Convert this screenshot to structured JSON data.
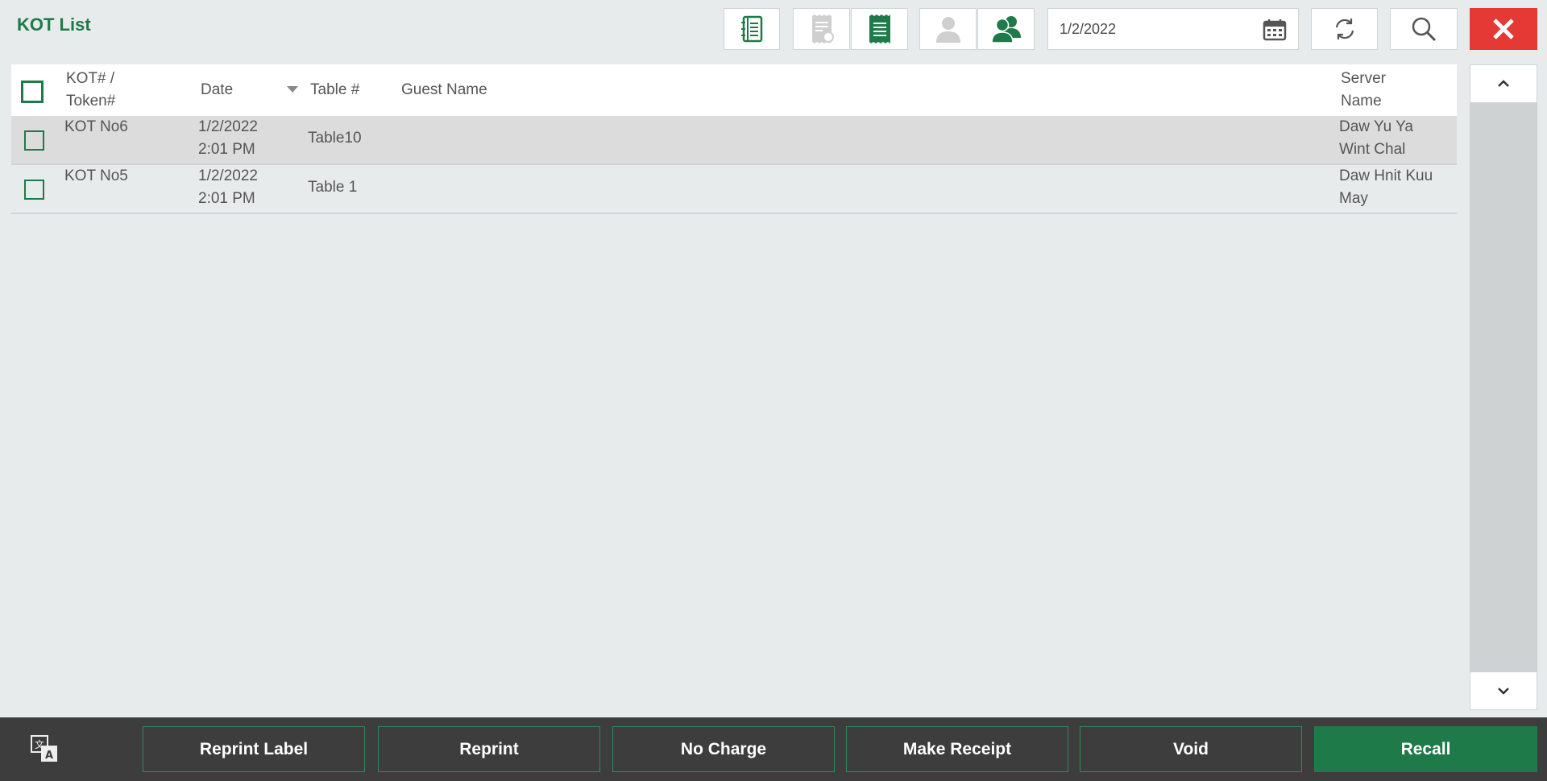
{
  "header": {
    "title": "KOT List",
    "date_value": "1/2/2022"
  },
  "toolbar": {
    "icons": [
      "kot-book-icon",
      "receipt-disabled-icon",
      "receipt-icon",
      "single-user-icon",
      "group-users-icon",
      "calendar-icon",
      "refresh-icon",
      "search-icon",
      "close-icon"
    ]
  },
  "table": {
    "headers": {
      "kot_line1": "KOT# /",
      "kot_line2": "Token#",
      "date": "Date",
      "table": "Table #",
      "guest": "Guest Name",
      "server_line1": "Server",
      "server_line2": "Name"
    },
    "rows": [
      {
        "kot": "KOT No6",
        "date_line1": "1/2/2022",
        "date_line2": "2:01 PM",
        "table": "Table10",
        "guest": "",
        "server_line1": "Daw Yu Ya",
        "server_line2": "Wint Chal",
        "highlighted": true
      },
      {
        "kot": "KOT No5",
        "date_line1": "1/2/2022",
        "date_line2": "2:01 PM",
        "table": "Table 1",
        "guest": "",
        "server_line1": "Daw Hnit Kuu",
        "server_line2": "May",
        "highlighted": false
      }
    ]
  },
  "footer": {
    "reprint_label": "Reprint Label",
    "reprint": "Reprint",
    "no_charge": "No Charge",
    "make_receipt": "Make Receipt",
    "void": "Void",
    "recall": "Recall"
  },
  "colors": {
    "accent_green": "#1f7a4a",
    "close_red": "#e53935",
    "footer_bg": "#3d3d3d",
    "row_highlight": "#dcdcdc"
  }
}
